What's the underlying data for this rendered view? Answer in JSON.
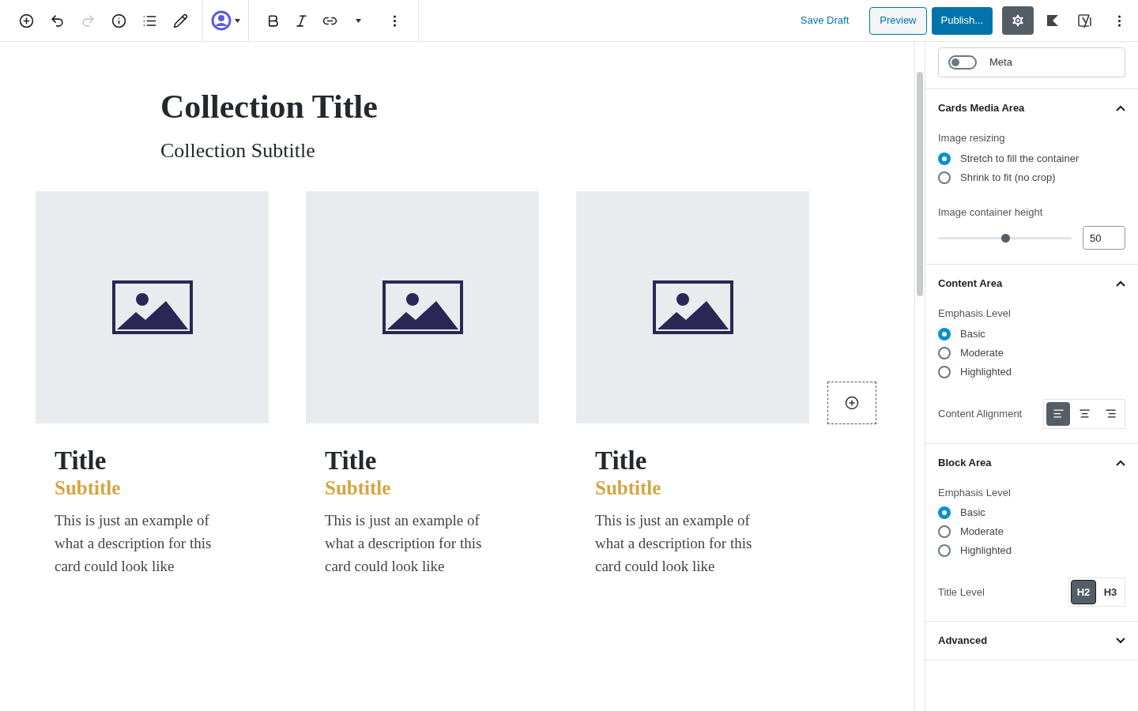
{
  "toolbar": {
    "redo": {
      "disabled": true
    },
    "actions": [
      {
        "kind": "link",
        "label": "Save Draft"
      },
      {
        "kind": "secondary",
        "label": "Preview"
      },
      {
        "kind": "primary",
        "label": "Publish..."
      }
    ],
    "settings": {
      "selected": true
    }
  },
  "collection": {
    "title": "Collection Title",
    "subtitle": "Collection Subtitle"
  },
  "cards": [
    {
      "title": "Title",
      "subtitle": "Subtitle",
      "description": "This is just an example of what a description for this card could look like"
    },
    {
      "title": "Title",
      "subtitle": "Subtitle",
      "description": "This is just an example of what a description for this card could look like"
    },
    {
      "title": "Title",
      "subtitle": "Subtitle",
      "description": "This is just an example of what a description for this card could look like"
    }
  ],
  "sidebar": {
    "meta": {
      "label": "Meta",
      "on": false
    },
    "panels": [
      {
        "title": "Cards Media Area",
        "expanded": true,
        "controls": [
          {
            "kind": "radio",
            "label": "Image resizing",
            "options": [
              {
                "label": "Stretch to fill the container",
                "selected": true
              },
              {
                "label": "Shrink to fit (no crop)",
                "selected": false
              }
            ]
          },
          {
            "kind": "slider",
            "label": "Image container height",
            "level": 0.5,
            "value": "50"
          }
        ]
      },
      {
        "title": "Content Area",
        "expanded": true,
        "controls": [
          {
            "kind": "radio",
            "label": "Emphasis Level",
            "options": [
              {
                "label": "Basic",
                "selected": true
              },
              {
                "label": "Moderate",
                "selected": false
              },
              {
                "label": "Highlighted",
                "selected": false
              }
            ]
          },
          {
            "kind": "align",
            "label": "Content Alignment",
            "options": [
              {
                "selected": true
              },
              {
                "selected": false
              },
              {
                "selected": false
              }
            ]
          }
        ]
      },
      {
        "title": "Block Area",
        "expanded": true,
        "controls": [
          {
            "kind": "radio",
            "label": "Emphasis Level",
            "options": [
              {
                "label": "Basic",
                "selected": true
              },
              {
                "label": "Moderate",
                "selected": false
              },
              {
                "label": "Highlighted",
                "selected": false
              }
            ]
          },
          {
            "kind": "segmented",
            "label": "Title Level",
            "options": [
              {
                "label": "H2",
                "selected": true
              },
              {
                "label": "H3",
                "selected": false
              }
            ]
          }
        ]
      },
      {
        "title": "Advanced",
        "expanded": false
      }
    ]
  }
}
